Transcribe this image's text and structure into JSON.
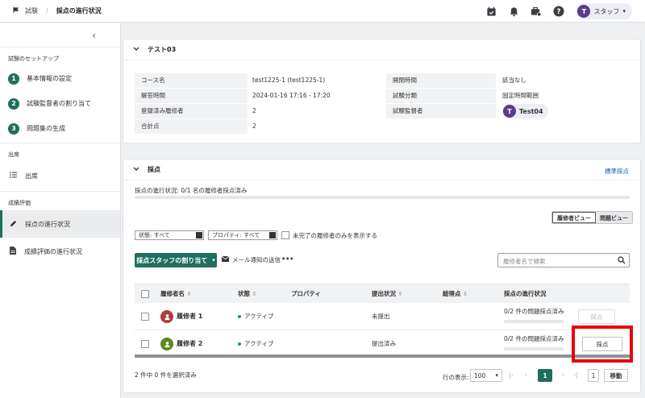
{
  "breadcrumb": {
    "root": "試験",
    "current": "採点の進行状況"
  },
  "user": {
    "initial": "T",
    "name": "スタッフ"
  },
  "sidebar": {
    "setup_title": "試験のセットアップ",
    "steps": [
      {
        "num": "1",
        "label": "基本情報の設定"
      },
      {
        "num": "2",
        "label": "試験監督者の割り当て"
      },
      {
        "num": "3",
        "label": "問題集の生成"
      }
    ],
    "attendance_title": "出席",
    "attendance_item": "出席",
    "grading_title": "成績評価",
    "grading_items": [
      "採点の進行状況",
      "成績評価の進行状況"
    ]
  },
  "exam": {
    "title": "テスト03",
    "fields": {
      "course_label": "コース名",
      "course_value": "test1225-1 (test1225-1)",
      "answer_time_label": "解答時間",
      "answer_time_value": "2024-01-16 17:16 - 17:20",
      "registered_label": "登録済み履修者",
      "registered_value": "2",
      "total_label": "合計点",
      "total_value": "2",
      "open_time_label": "開閉時間",
      "open_time_value": "該当なし",
      "category_label": "試験分類",
      "category_value": "固定時間範囲",
      "proctor_label": "試験監督者",
      "proctor_initial": "T",
      "proctor_value": "Test04"
    }
  },
  "grading": {
    "title": "採点",
    "standard_link": "標準採点",
    "progress_text": "採点の進行状況: 0/1 名の履修者採点済み",
    "progress_fraction": 0.0,
    "view_toggle": {
      "student": "履修者ビュー",
      "question": "問題ビュー"
    },
    "filter_status": "状態: すべて",
    "filter_property": "プロパティ: すべて",
    "incomplete_only": "未完了の履修者のみを表示する",
    "assign_button": "採点スタッフの割り当て",
    "mail_button": "メール通知の送信",
    "more": "•••",
    "search_placeholder": "履修者名で検索",
    "columns": [
      "履修者名",
      "状態",
      "プロパティ",
      "提出状況",
      "総得点",
      "採点の進行状況"
    ],
    "rows": [
      {
        "name": "履修者 1",
        "status": "アクティブ",
        "submission": "未提出",
        "progress": "0/2 件の問題採点済み",
        "button": "採点",
        "avatar_color": "#b23a3a",
        "enabled": false
      },
      {
        "name": "履修者 2",
        "status": "アクティブ",
        "submission": "提出済み",
        "progress": "0/2 件の問題採点済み",
        "button": "採点",
        "avatar_color": "#5a8a1e",
        "enabled": true
      }
    ],
    "selected_count": "2 件中 0 件を選択済み",
    "rows_per_page_label": "行の表示:",
    "rows_per_page": "100",
    "page_current": "1",
    "page_input": "1",
    "go_button": "移動"
  },
  "colors": {
    "accent": "#1f6e5f",
    "highlight": "#e8000b"
  }
}
